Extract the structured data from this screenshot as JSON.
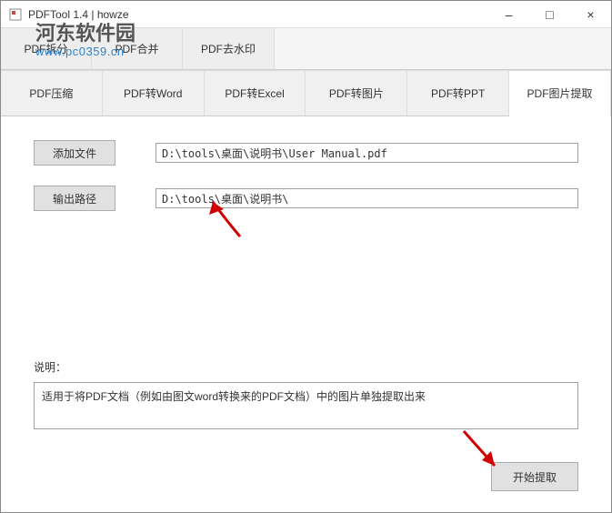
{
  "window": {
    "title": "PDFTool 1.4 | howze",
    "minimize": "–",
    "maximize": "□",
    "close": "×"
  },
  "watermark": {
    "main": "河东软件园",
    "sub": "www.pc0359.cn"
  },
  "tabsRow1": [
    {
      "label": "PDF拆分"
    },
    {
      "label": "PDF合并"
    },
    {
      "label": "PDF去水印"
    }
  ],
  "tabsRow2": [
    {
      "label": "PDF压缩",
      "active": false
    },
    {
      "label": "PDF转Word",
      "active": false
    },
    {
      "label": "PDF转Excel",
      "active": false
    },
    {
      "label": "PDF转图片",
      "active": false
    },
    {
      "label": "PDF转PPT",
      "active": false
    },
    {
      "label": "PDF图片提取",
      "active": true
    }
  ],
  "buttons": {
    "addFile": "添加文件",
    "outputPath": "输出路径",
    "start": "开始提取"
  },
  "inputs": {
    "filePath": "D:\\tools\\桌面\\说明书\\User Manual.pdf",
    "outputPath": "D:\\tools\\桌面\\说明书\\"
  },
  "description": {
    "label": "说明：",
    "text": "适用于将PDF文档（例如由图文word转换来的PDF文档）中的图片单独提取出来"
  }
}
